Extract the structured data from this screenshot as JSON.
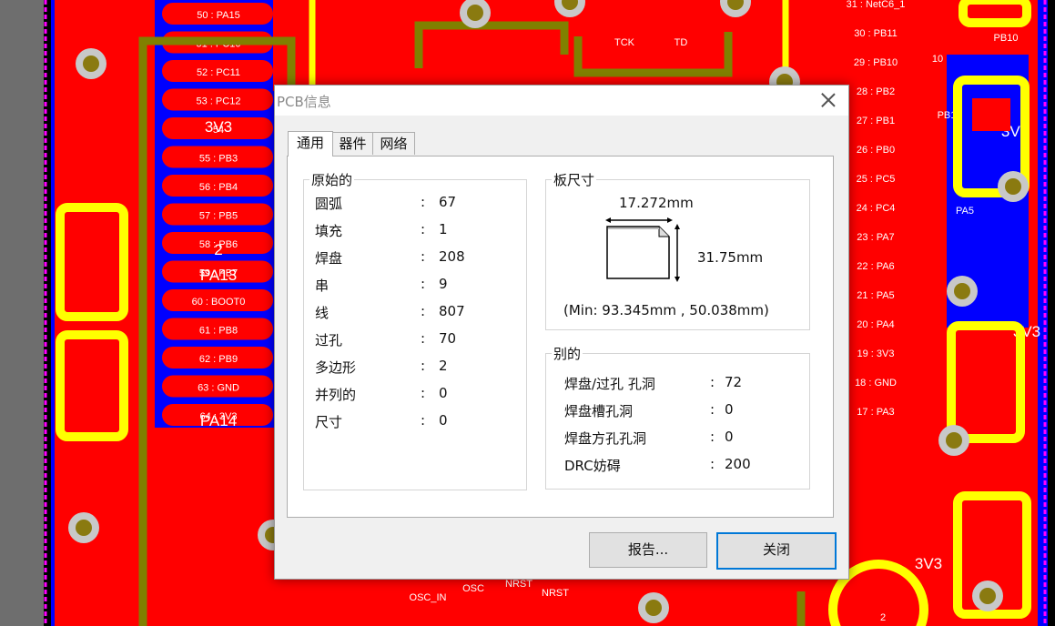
{
  "pcb": {
    "pin_labels_left": [
      "50 : PA15",
      "51 : PC10",
      "52 : PC11",
      "53 : PC12",
      "54",
      "55 : PB3",
      "56 : PB4",
      "57 : PB5",
      "58 : PB6",
      "59 : PB7",
      "60 : BOOT0",
      "61 : PB8",
      "62 : PB9",
      "63 : GND",
      "64 : 3V3"
    ],
    "pin_labels_right": [
      "31 : NetC6_1",
      "30 : PB11",
      "29 : PB10",
      "28 : PB2",
      "27 : PB1",
      "26 : PB0",
      "25 : PC5",
      "24 : PC4",
      "23 : PA7",
      "22 : PA6",
      "21 : PA5",
      "20 : PA4",
      "19 : 3V3",
      "18 : GND",
      "17 : PA3"
    ],
    "big_labels": [
      "3V3",
      "2",
      "PA13",
      "PA14",
      "3V3",
      "3V3",
      "3V3"
    ],
    "small_labels": [
      "TCK",
      "TD",
      "OSC_IN",
      "OSC",
      "NRST",
      "NRST",
      "PB1",
      "PB10",
      "PA5",
      "10",
      "2"
    ],
    "colors": {
      "board": "#ff0000",
      "bottom_layer": "#0000ff",
      "trace_olive": "#808000",
      "pad_yellow": "#ffff00",
      "outline_magenta": "#ff00ff",
      "background": "#6e6e6e"
    }
  },
  "dialog": {
    "title": "PCB信息",
    "tabs": [
      "通用",
      "器件",
      "网络"
    ],
    "primitives": {
      "title": "原始的",
      "rows": [
        {
          "label": "圆弧",
          "value": "67"
        },
        {
          "label": "填充",
          "value": "1"
        },
        {
          "label": "焊盘",
          "value": "208"
        },
        {
          "label": "串",
          "value": "9"
        },
        {
          "label": "线",
          "value": "807"
        },
        {
          "label": "过孔",
          "value": "70"
        },
        {
          "label": "多边形",
          "value": "2"
        },
        {
          "label": "并列的",
          "value": "0"
        },
        {
          "label": "尺寸",
          "value": "0"
        }
      ]
    },
    "board_size": {
      "title": "板尺寸",
      "width": "17.272mm",
      "height": "31.75mm",
      "min": "(Min: 93.345mm , 50.038mm)"
    },
    "other": {
      "title": "别的",
      "rows": [
        {
          "label": "焊盘/过孔 孔洞",
          "value": "72"
        },
        {
          "label": "焊盘槽孔洞",
          "value": "0"
        },
        {
          "label": "焊盘方孔孔洞",
          "value": "0"
        },
        {
          "label": "DRC妨碍",
          "value": "200"
        }
      ]
    },
    "colon": ":",
    "report_button": "报告...",
    "close_button": "关闭"
  }
}
